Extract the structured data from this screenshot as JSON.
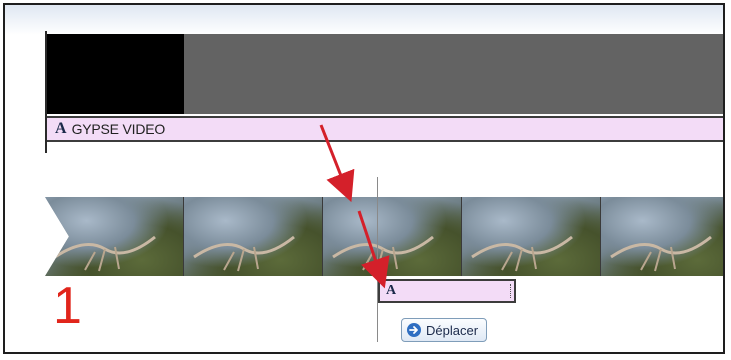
{
  "timeline": {
    "title_track": {
      "icon_letter": "A",
      "title": "GYPSE VIDEO"
    },
    "caption_clip": {
      "icon_letter": "A"
    },
    "move_button": {
      "label": "Déplacer",
      "icon": "arrow-right-icon"
    }
  },
  "annotation": {
    "step_number": "1",
    "arrow_color": "#d4202a"
  },
  "colors": {
    "title_clip_bg": "#f3dcf7",
    "video_track_bg": "#636363",
    "step_number": "#e1251b"
  }
}
